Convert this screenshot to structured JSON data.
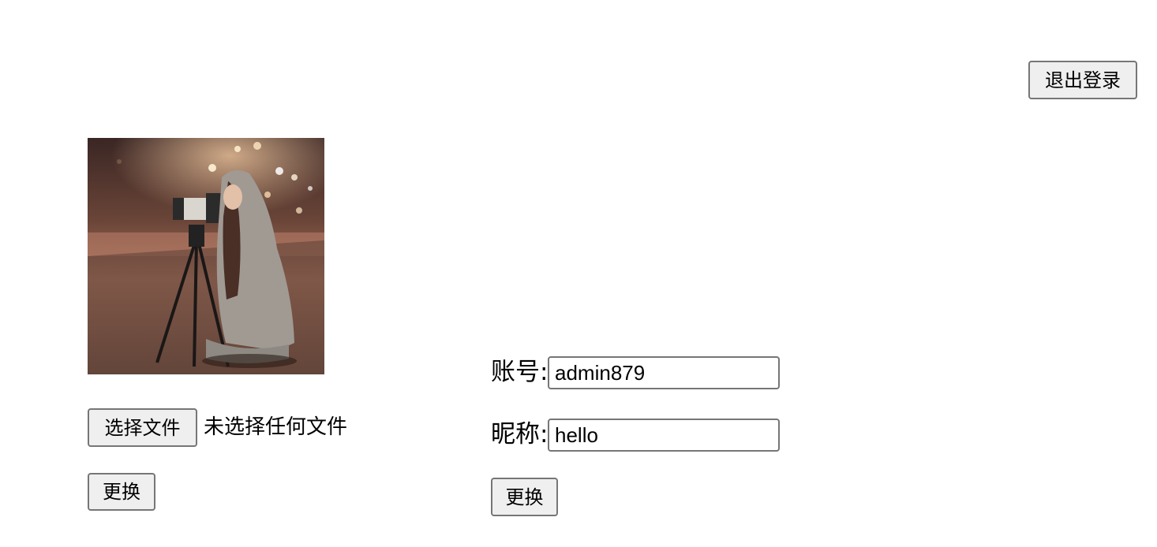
{
  "header": {
    "logout_label": "退出登录"
  },
  "avatar_section": {
    "choose_file_label": "选择文件",
    "no_file_text": "未选择任何文件",
    "replace_label": "更换"
  },
  "profile": {
    "account_label": "账号:",
    "account_value": "admin879",
    "nickname_label": "昵称:",
    "nickname_value": "hello",
    "replace_label": "更换"
  }
}
